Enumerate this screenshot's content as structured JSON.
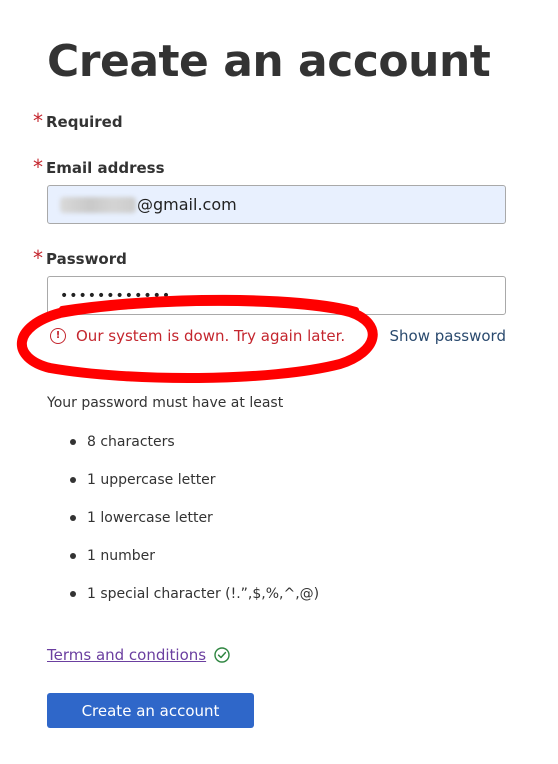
{
  "page": {
    "title": "Create an account"
  },
  "form": {
    "required_star": "*",
    "required_label": "Required",
    "email": {
      "label": "Email address",
      "value_domain": "@gmail.com"
    },
    "password": {
      "label": "Password",
      "value": "••••••••••••"
    },
    "error_text": "Our system is down. Try again later.",
    "show_password_label": "Show password",
    "rules": {
      "intro": "Your password must have at least",
      "items": [
        "8 characters",
        "1 uppercase letter",
        "1 lowercase letter",
        "1 number",
        "1 special character (!.”,$,%,^,@)"
      ]
    },
    "terms_label": "Terms and conditions",
    "submit_label": "Create an account"
  },
  "colors": {
    "error": "#c4262e",
    "primary_button": "#2f67c9",
    "link_visited": "#6b3fa0",
    "annotation": "#ff0000",
    "success_check": "#2e8540",
    "autofill_bg": "#e8f0fe"
  },
  "icons": {
    "error": "exclamation-circle-icon",
    "terms_status": "check-circle-icon"
  }
}
